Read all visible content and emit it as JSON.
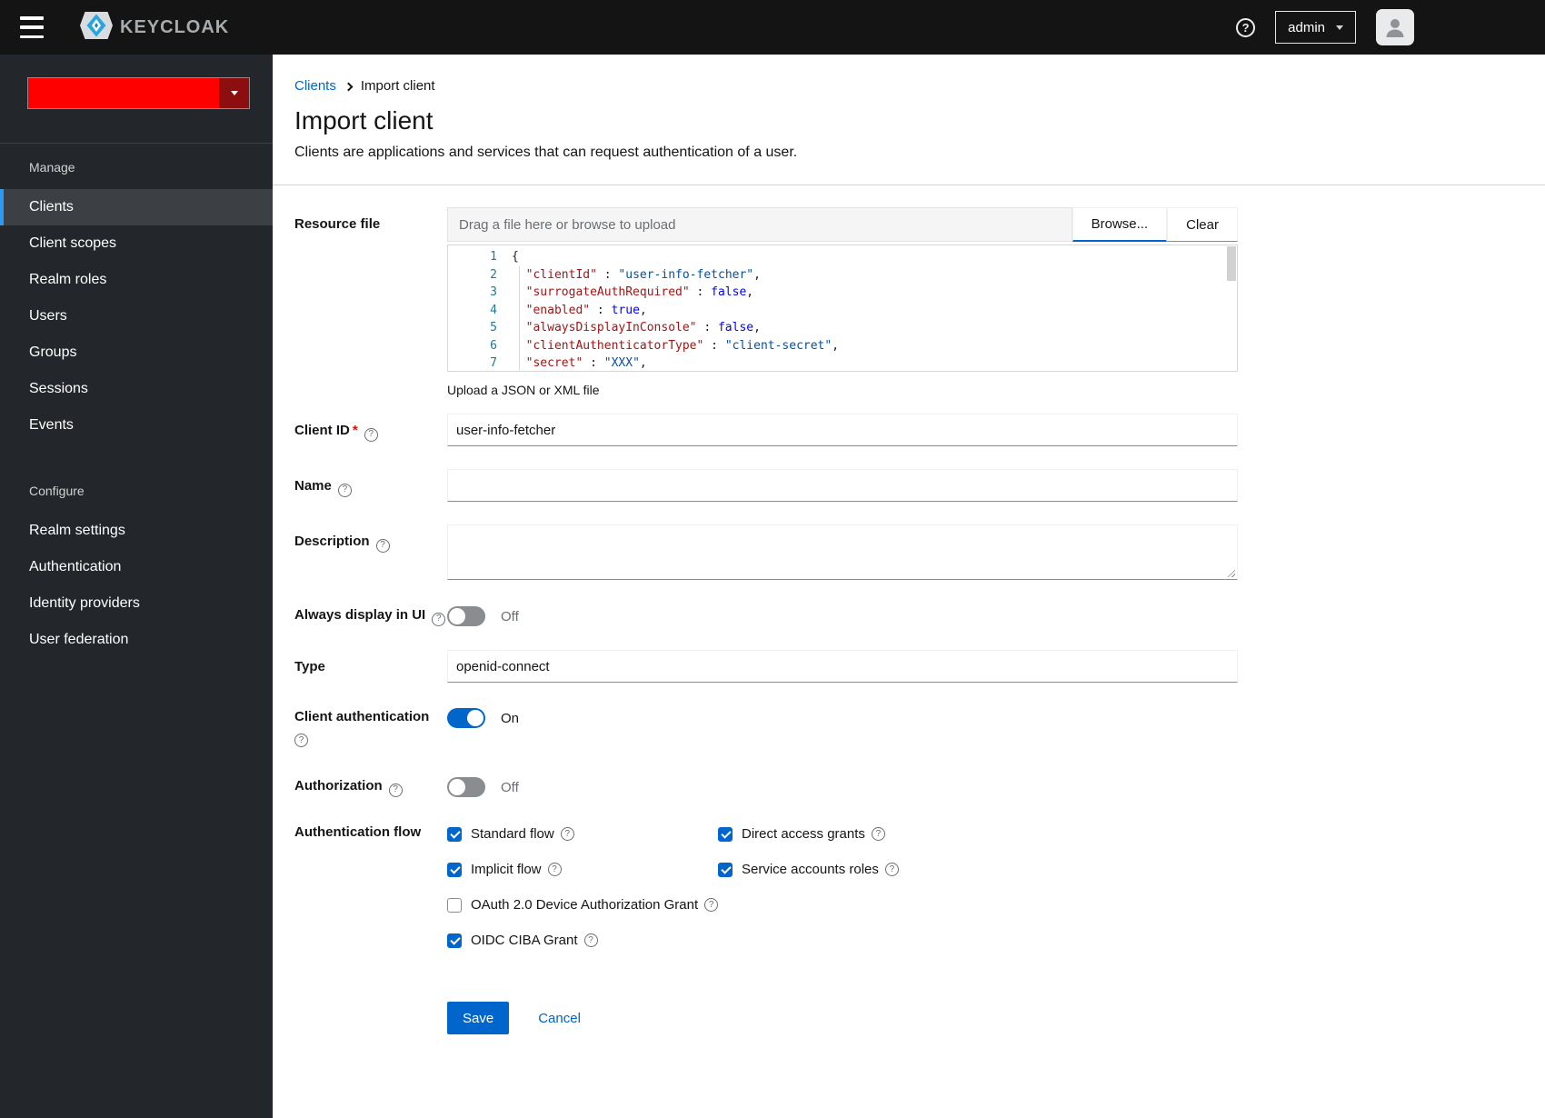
{
  "colors": {
    "accent": "#0066cc",
    "realm_redaction": "#ff0000",
    "nav_selected_border": "#2b9af3",
    "required_asterisk": "#c9190b",
    "code_key": "#a31515",
    "code_string": "#0451a5",
    "code_boolean": "#0000ff",
    "code_line_number": "#237893"
  },
  "icons": {
    "help": "?"
  },
  "topbar": {
    "brand": "KEYCLOAK",
    "user": "admin"
  },
  "sidebar": {
    "manage_header": "Manage",
    "manage_items": [
      "Clients",
      "Client scopes",
      "Realm roles",
      "Users",
      "Groups",
      "Sessions",
      "Events"
    ],
    "selected_item": "Clients",
    "configure_header": "Configure",
    "configure_items": [
      "Realm settings",
      "Authentication",
      "Identity providers",
      "User federation"
    ]
  },
  "breadcrumb": {
    "parent": "Clients",
    "current": "Import client"
  },
  "page": {
    "title": "Import client",
    "subtitle": "Clients are applications and services that can request authentication of a user."
  },
  "resource_file": {
    "label": "Resource file",
    "placeholder": "Drag a file here or browse to upload",
    "browse": "Browse...",
    "clear": "Clear",
    "helper": "Upload a JSON or XML file"
  },
  "editor": {
    "lines": [
      {
        "num": "1",
        "ind": "",
        "key": "",
        "sep": "",
        "sval": "",
        "bval": "",
        "tail": "{"
      },
      {
        "num": "2",
        "ind": "  ",
        "key": "\"clientId\"",
        "sep": " : ",
        "sval": "\"user-info-fetcher\"",
        "bval": "",
        "tail": ","
      },
      {
        "num": "3",
        "ind": "  ",
        "key": "\"surrogateAuthRequired\"",
        "sep": " : ",
        "sval": "",
        "bval": "false",
        "tail": ","
      },
      {
        "num": "4",
        "ind": "  ",
        "key": "\"enabled\"",
        "sep": " : ",
        "sval": "",
        "bval": "true",
        "tail": ","
      },
      {
        "num": "5",
        "ind": "  ",
        "key": "\"alwaysDisplayInConsole\"",
        "sep": " : ",
        "sval": "",
        "bval": "false",
        "tail": ","
      },
      {
        "num": "6",
        "ind": "  ",
        "key": "\"clientAuthenticatorType\"",
        "sep": " : ",
        "sval": "\"client-secret\"",
        "bval": "",
        "tail": ","
      },
      {
        "num": "7",
        "ind": "  ",
        "key": "\"secret\"",
        "sep": " : ",
        "sval": "\"XXX\"",
        "bval": "",
        "tail": ","
      }
    ]
  },
  "form": {
    "client_id": {
      "label": "Client ID",
      "required": "*",
      "value": "user-info-fetcher"
    },
    "name": {
      "label": "Name",
      "value": ""
    },
    "description": {
      "label": "Description",
      "value": ""
    },
    "always_display": {
      "label": "Always display in UI",
      "state": "Off",
      "on": false
    },
    "type": {
      "label": "Type",
      "value": "openid-connect"
    },
    "client_auth": {
      "label": "Client authentication",
      "state": "On",
      "on": true
    },
    "authorization": {
      "label": "Authorization",
      "state": "Off",
      "on": false
    },
    "auth_flow": {
      "label": "Authentication flow",
      "options": [
        {
          "label": "Standard flow",
          "checked": true
        },
        {
          "label": "Direct access grants",
          "checked": true
        },
        {
          "label": "Implicit flow",
          "checked": true
        },
        {
          "label": "Service accounts roles",
          "checked": true
        },
        {
          "label": "OAuth 2.0 Device Authorization Grant",
          "checked": false
        },
        {
          "label": "OIDC CIBA Grant",
          "checked": true
        }
      ]
    }
  },
  "actions": {
    "save": "Save",
    "cancel": "Cancel"
  }
}
